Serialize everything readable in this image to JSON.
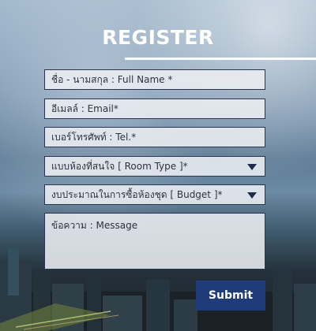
{
  "form": {
    "title": "REGISTER",
    "full_name_placeholder": "ชื่อ - นามสกุล : Full Name *",
    "email_placeholder": "อีเมลล์ : Email*",
    "tel_placeholder": "เบอร์โทรศัพท์ : Tel.*",
    "room_type_selected": "แบบห้องที่สนใจ [ Room Type ]*",
    "budget_selected": "งบประมาณในการซื้อห้องชุด [ Budget ]*",
    "message_placeholder": "ข้อความ : Message",
    "submit_label": "Submit"
  },
  "colors": {
    "accent": "#1f3c78",
    "field_border": "#2a3550",
    "field_bg": "#eceef3",
    "caret": "#1f2d4d"
  },
  "icons": {
    "room_type_caret": "chevron-down-icon",
    "budget_caret": "chevron-down-icon"
  }
}
